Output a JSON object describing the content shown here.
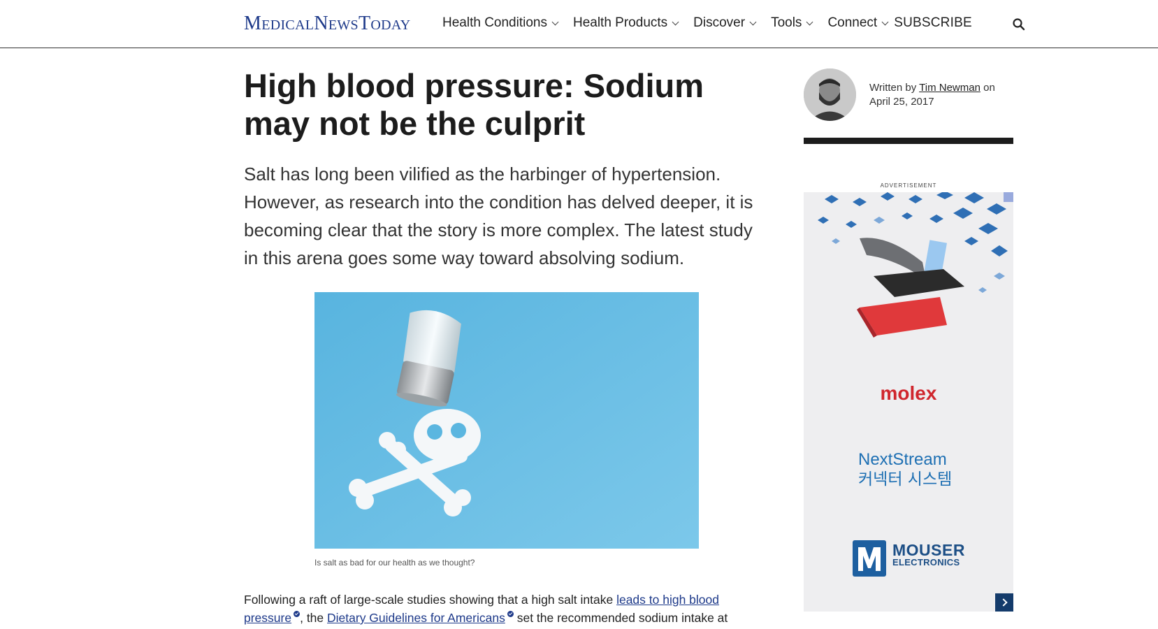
{
  "header": {
    "logo": {
      "part1_cap": "M",
      "part1_rest": "EDICAL",
      "part2_cap": "N",
      "part2_rest": "EWS",
      "part3_cap": "T",
      "part3_rest": "ODAY"
    },
    "nav": [
      {
        "label": "Health Conditions",
        "has_dropdown": true
      },
      {
        "label": "Health Products",
        "has_dropdown": true
      },
      {
        "label": "Discover",
        "has_dropdown": true
      },
      {
        "label": "Tools",
        "has_dropdown": true
      },
      {
        "label": "Connect",
        "has_dropdown": true
      }
    ],
    "subscribe_label": "SUBSCRIBE",
    "search_icon": "search-icon"
  },
  "article": {
    "title": "High blood pressure: Sodium may not be the culprit",
    "lede": "Salt has long been vilified as the harbinger of hypertension. However, as research into the condition has delved deeper, it is becoming clear that the story is more complex. The latest study in this arena goes some way toward absolving sodium.",
    "image_caption": "Is salt as bad for our health as we thought?",
    "body": {
      "text1": "Following a raft of large-scale studies showing that a high salt intake ",
      "link1": "leads to high blood pressure",
      "text2": ", the ",
      "link2": "Dietary Guidelines for Americans",
      "text3": " set the recommended sodium intake at"
    }
  },
  "byline": {
    "prefix": "Written by ",
    "author": "Tim Newman",
    "suffix": " on",
    "date": "April 25, 2017"
  },
  "ad": {
    "label": "ADVERTISEMENT",
    "brand": "molex",
    "product_line1": "NextStream",
    "product_line2": "커넥터 시스템",
    "sponsor_line1": "MOUSER",
    "sponsor_line2": "ELECTRONICS"
  },
  "colors": {
    "brand_blue": "#1e3a8a",
    "molex_red": "#d0262d",
    "ad_blue": "#1d6fb3",
    "image_background": "#5bb6e0"
  }
}
